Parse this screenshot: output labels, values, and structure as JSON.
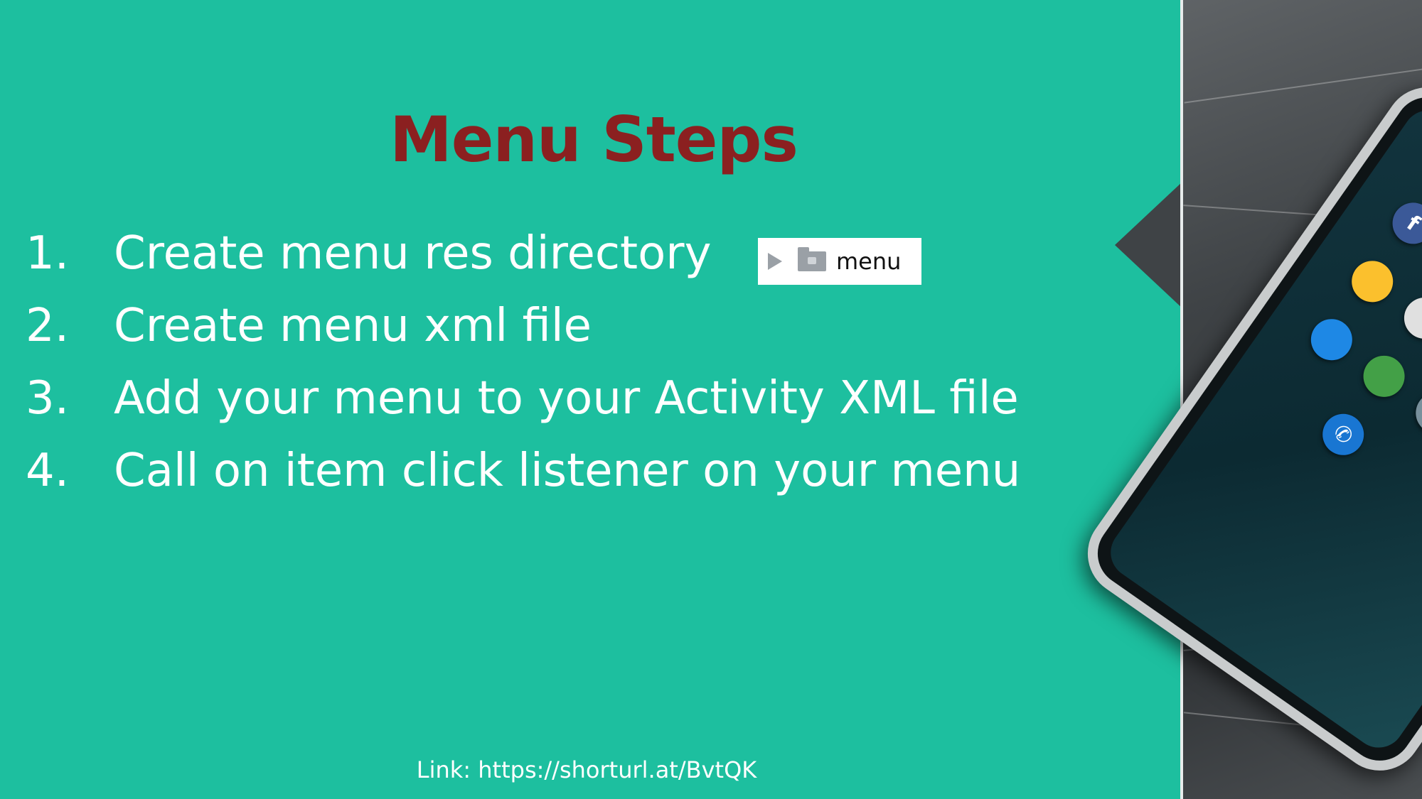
{
  "slide": {
    "title": "Menu Steps",
    "steps": [
      {
        "number": "1.",
        "text": "Create menu res directory"
      },
      {
        "number": "2.",
        "text": "Create menu xml file"
      },
      {
        "number": "3.",
        "text": "Add your menu to your Activity XML file"
      },
      {
        "number": "4.",
        "text": "Call on item click listener on your menu"
      }
    ],
    "folder_chip": {
      "label": "menu",
      "icons": [
        "expand-arrow-icon",
        "folder-icon"
      ]
    },
    "link": "Link: https://shorturl.at/BvtQK"
  },
  "colors": {
    "background": "#1dbf9f",
    "title": "#8b2020",
    "text": "#ffffff"
  }
}
